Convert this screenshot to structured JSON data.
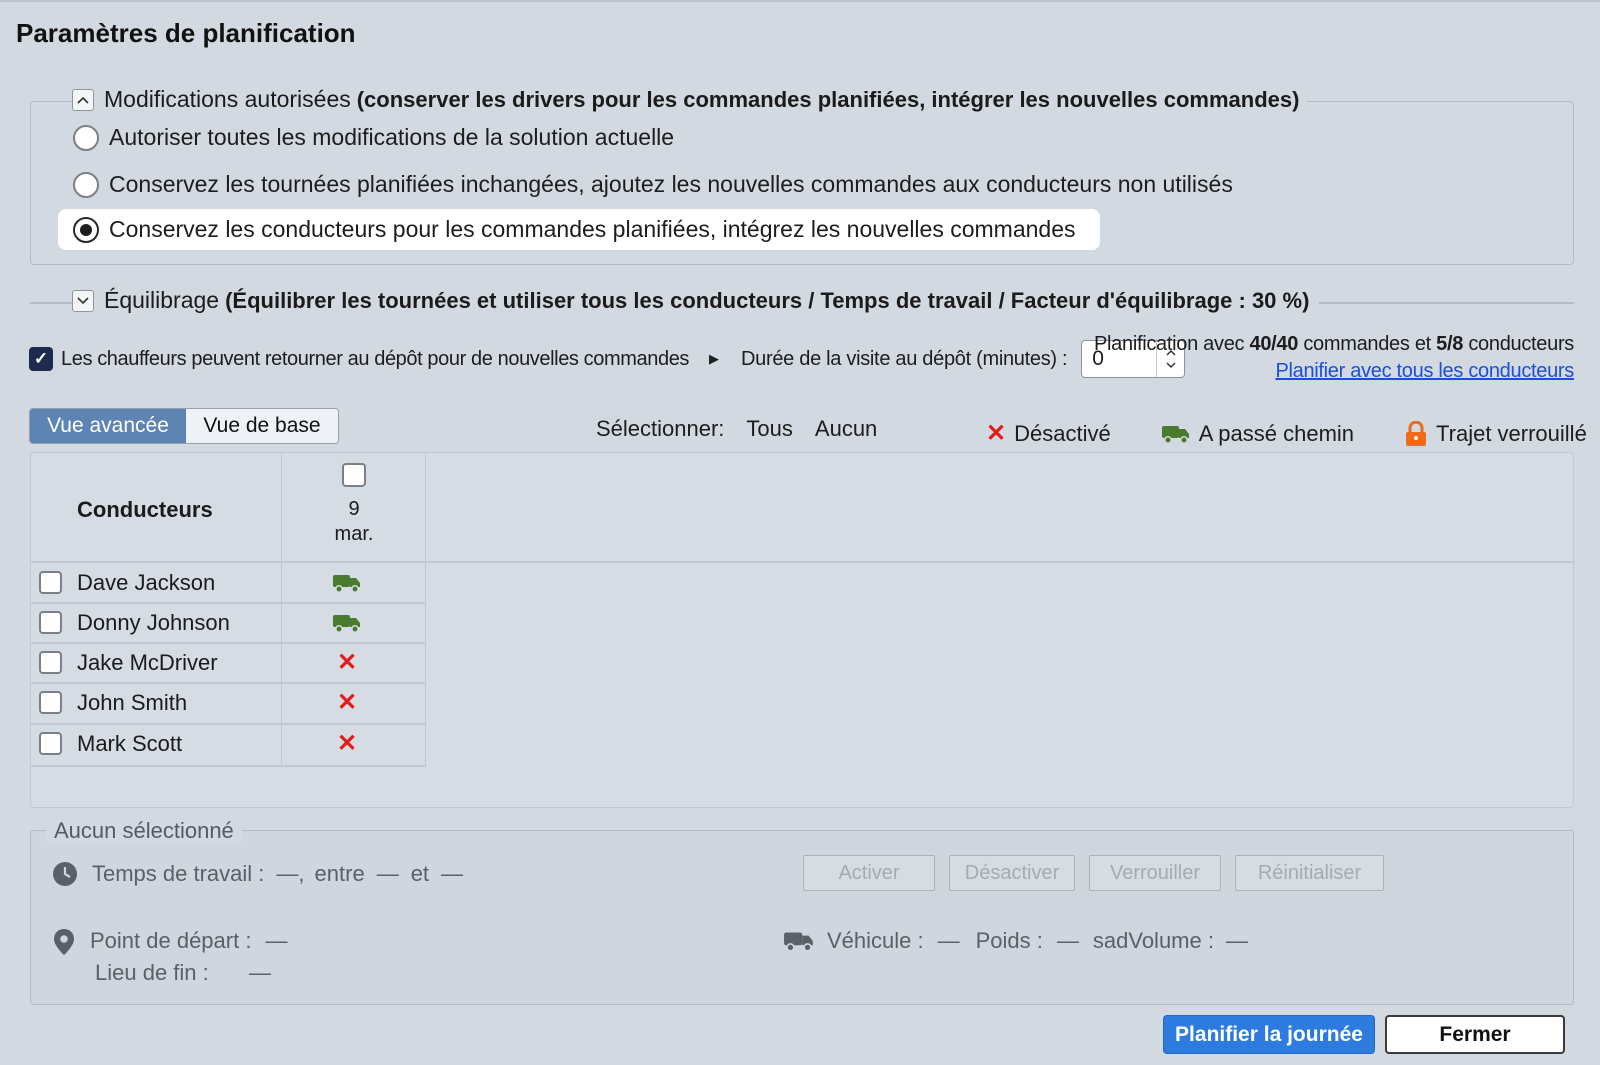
{
  "page": {
    "title": "Paramètres de planification"
  },
  "modifications": {
    "legend_title": "Modifications autorisées",
    "legend_detail": "(conserver les drivers pour les commandes planifiées, intégrer les nouvelles commandes)",
    "options": [
      {
        "label": "Autoriser toutes les modifications de la solution actuelle",
        "selected": false
      },
      {
        "label": "Conservez les tournées planifiées inchangées, ajoutez les nouvelles commandes aux conducteurs non utilisés",
        "selected": false
      },
      {
        "label": "Conservez les conducteurs pour les commandes planifiées, intégrez les nouvelles commandes",
        "selected": true
      }
    ]
  },
  "equilibrage": {
    "legend_title": "Équilibrage",
    "legend_detail": "(Équilibrer les tournées et utiliser tous les conducteurs / Temps de travail / Facteur d'équilibrage : 30 %)"
  },
  "options_row": {
    "return_depot_label": "Les chauffeurs peuvent retourner au dépôt pour de nouvelles commandes",
    "return_depot_checked": true,
    "duree_label": "Durée de la visite au dépôt (minutes) :",
    "duree_value": "0"
  },
  "plan_info": {
    "prefix": "Planification avec",
    "orders": "40/40",
    "middle": "commandes et",
    "drivers": "5/8",
    "suffix": "conducteurs",
    "link": "Planifier avec tous les conducteurs"
  },
  "view_toggle": {
    "advanced": "Vue avancée",
    "basic": "Vue de base",
    "active": "advanced"
  },
  "select": {
    "label": "Sélectionner:",
    "all": "Tous",
    "none": "Aucun"
  },
  "legend": {
    "disabled": "Désactivé",
    "passed": "A passé chemin",
    "locked": "Trajet verrouillé"
  },
  "table": {
    "header_drivers": "Conducteurs",
    "date_day": "9",
    "date_month": "mar.",
    "rows": [
      {
        "name": "Dave Jackson",
        "status": "passed"
      },
      {
        "name": "Donny Johnson",
        "status": "passed"
      },
      {
        "name": "Jake McDriver",
        "status": "disabled"
      },
      {
        "name": "John Smith",
        "status": "disabled"
      },
      {
        "name": "Mark Scott",
        "status": "disabled"
      }
    ]
  },
  "details": {
    "legend": "Aucun sélectionné",
    "work_time_label": "Temps de travail :",
    "work_time_value": "—,",
    "between": "entre",
    "between_value": "—",
    "and": "et",
    "and_value": "—",
    "buttons": {
      "activate": "Activer",
      "deactivate": "Désactiver",
      "lock": "Verrouiller",
      "reset": "Réinitialiser"
    },
    "start_label": "Point de départ :",
    "start_value": "—",
    "end_label": "Lieu de fin :",
    "end_value": "—",
    "vehicle_label": "Véhicule :",
    "vehicle_value": "—",
    "weight_label": "Poids :",
    "weight_value": "—",
    "volume_label": "sadVolume :",
    "volume_value": "—"
  },
  "footer": {
    "plan_day": "Planifier la journée",
    "close": "Fermer"
  },
  "colors": {
    "accent": "#2e7be0",
    "toggle_active": "#5e84b4",
    "truck_green": "#4a7a2e",
    "disabled_red": "#e21b1b",
    "lock_orange": "#f06a1b"
  },
  "icons": {
    "collapse": "chevron-up-icon",
    "expand": "chevron-down-icon",
    "passed": "truck-icon",
    "disabled": "x-icon",
    "locked": "lock-icon",
    "clock": "clock-icon",
    "pin": "location-pin-icon",
    "vehicle": "truck-icon"
  }
}
